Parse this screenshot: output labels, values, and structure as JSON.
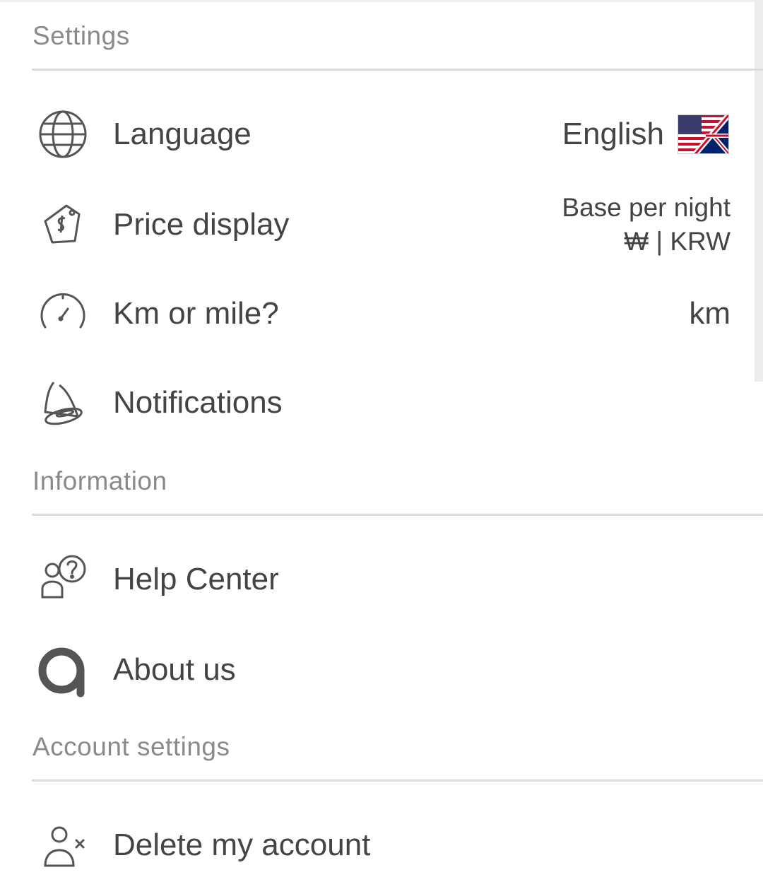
{
  "sections": {
    "settings": "Settings",
    "information": "Information",
    "account": "Account settings"
  },
  "rows": {
    "language": {
      "label": "Language",
      "value": "English",
      "icon": "globe-icon",
      "flag": "us-uk-flag-icon"
    },
    "price": {
      "label": "Price display",
      "value_line1": "Base per night",
      "value_line2": "₩ | KRW",
      "icon": "price-tag-icon"
    },
    "distance": {
      "label": "Km or mile?",
      "value": "km",
      "icon": "speedometer-icon"
    },
    "notifications": {
      "label": "Notifications",
      "icon": "bell-icon"
    },
    "help": {
      "label": "Help Center",
      "icon": "help-person-icon"
    },
    "about": {
      "label": "About us",
      "icon": "agoda-logo-icon"
    },
    "delete": {
      "label": "Delete my account",
      "icon": "delete-user-icon"
    }
  },
  "colors": {
    "text": "#444444",
    "section_header": "#8a8a8a",
    "divider": "#dcdcdc"
  }
}
